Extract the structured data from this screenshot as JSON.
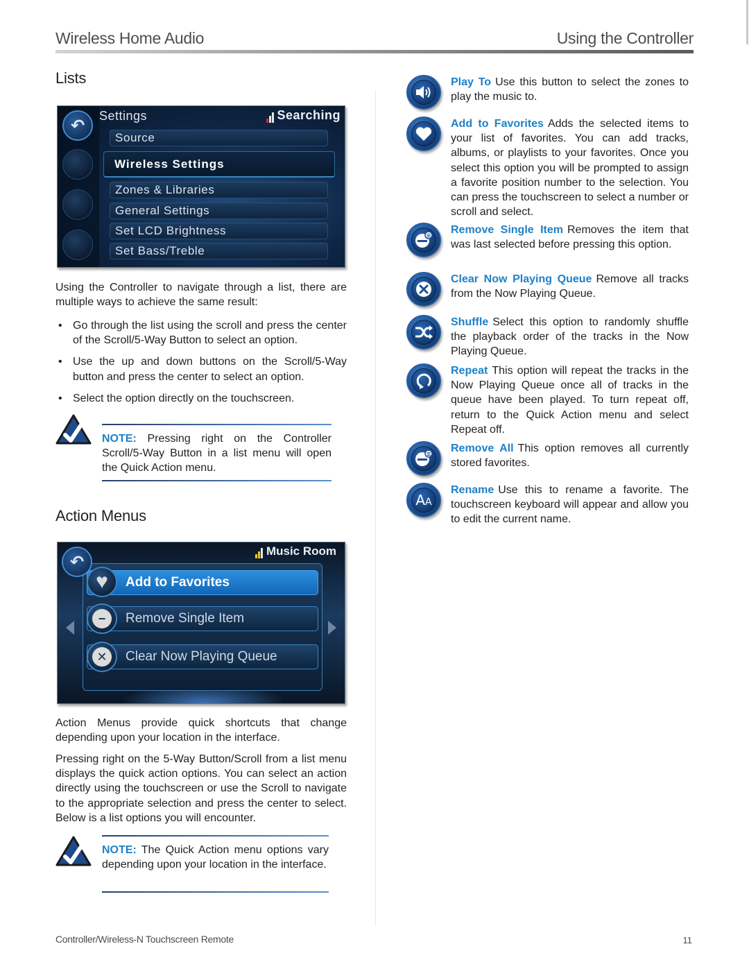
{
  "header": {
    "left_title": "Wireless Home Audio",
    "right_title": "Using the Controller"
  },
  "lists_section": {
    "title": "Lists",
    "screen": {
      "title": "Settings",
      "status": "Searching",
      "items": [
        {
          "label": "Source",
          "selected": false
        },
        {
          "label": "Wireless Settings",
          "selected": true
        },
        {
          "label": "Zones & Libraries",
          "selected": false
        },
        {
          "label": "General Settings",
          "selected": false
        },
        {
          "label": "Set LCD Brightness",
          "selected": false
        },
        {
          "label": "Set Bass/Treble",
          "selected": false
        }
      ]
    },
    "intro": "Using the Controller to navigate through a list, there are multiple ways to achieve the same result:",
    "bullets": [
      "Go through the list using the scroll and press the center of the Scroll/5-Way Button to select an option.",
      "Use the up and down buttons on the Scroll/5-Way button and press the center to select an option.",
      "Select the option directly on the touchscreen."
    ],
    "note": {
      "label": "NOTE:",
      "text": "Pressing right on the Controller Scroll/5-Way Button in a list menu will open the Quick Action menu."
    }
  },
  "action_menus_section": {
    "title": "Action Menus",
    "screen": {
      "status": "Music Room",
      "items": [
        {
          "label": "Add to Favorites",
          "icon": "heart-icon",
          "selected": true
        },
        {
          "label": "Remove Single Item",
          "icon": "remove-item-icon",
          "selected": false
        },
        {
          "label": "Clear Now Playing Queue",
          "icon": "clear-queue-icon",
          "selected": false
        }
      ]
    },
    "paragraphs": [
      "Action Menus provide quick shortcuts that change depending upon your location in the interface.",
      "Pressing right on the 5-Way Button/Scroll from a list menu displays the quick action options. You can select an action directly using the touchscreen or use the Scroll to navigate to the appropriate selection and press the center to select. Below is a list options you will encounter."
    ],
    "note": {
      "label": "NOTE:",
      "text": "The Quick Action menu options vary depending upon your location in the interface."
    }
  },
  "options": [
    {
      "icon": "play-to-icon",
      "label": "Play To",
      "text": "Use this button to select the zones to play the music to."
    },
    {
      "icon": "heart-icon",
      "label": "Add to Favorites",
      "text": "Adds the selected items to your list of favorites. You can add tracks, albums, or playlists to your favorites. Once you select this option you will be prompted to assign a favorite position number to the selection. You can press the touchscreen to select a number or scroll and select."
    },
    {
      "icon": "remove-item-icon",
      "label": "Remove Single Item",
      "text": "Removes the item that was last selected before pressing this option."
    },
    {
      "icon": "clear-queue-icon",
      "label": "Clear Now Playing Queue",
      "text": "Remove all tracks from the Now Playing Queue."
    },
    {
      "icon": "shuffle-icon",
      "label": "Shuffle",
      "text": "Select this option to randomly shuffle the playback order of the tracks in the Now Playing Queue."
    },
    {
      "icon": "repeat-icon",
      "label": "Repeat",
      "text": "This option will repeat the tracks in the Now Playing Queue once all of tracks in the queue have been played.  To turn repeat off, return to the Quick Action menu and select Repeat off."
    },
    {
      "icon": "remove-all-icon",
      "label": "Remove All",
      "text": "This option removes all currently stored favorites."
    },
    {
      "icon": "rename-icon",
      "label": "Rename",
      "text": "Use this to rename a favorite. The touchscreen keyboard will appear and allow you to edit the current name."
    }
  ],
  "footer": {
    "left": "Controller/Wireless-N Touchscreen Remote",
    "page_number": "11"
  },
  "colors": {
    "accent_blue": "#1f80c8",
    "header_gray": "#4d4d4f"
  }
}
